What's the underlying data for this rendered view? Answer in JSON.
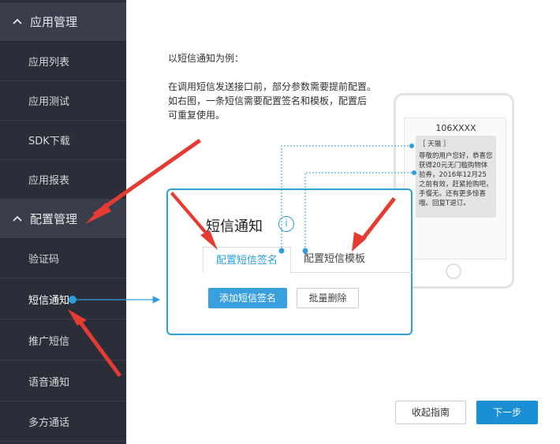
{
  "sidebar": {
    "sections": [
      {
        "title": "应用管理",
        "items": [
          "应用列表",
          "应用测试",
          "SDK下载",
          "应用报表"
        ]
      },
      {
        "title": "配置管理",
        "items": [
          "验证码",
          "短信通知",
          "推广短信",
          "语音通知",
          "多方通话"
        ]
      }
    ]
  },
  "guide": {
    "intro_title": "以短信通知为例：",
    "intro_lines": [
      "在调用短信发送接口前，部分参数需要提前配置。",
      "如右图，一条短信需要配置签名和模板，配置后",
      "可重复使用。"
    ],
    "card": {
      "title": "短信通知",
      "info_glyph": "i",
      "tab_signature": "配置短信签名",
      "tab_template": "配置短信模板",
      "add_button": "添加短信签名",
      "batch_delete_button": "批量删除"
    },
    "phone": {
      "sender": "106XXXX",
      "signature": "［ 天猫 ］",
      "message": "尊敬的用户您好，恭喜您获得20元无门槛购物体验券，2016年12月25之前有效，赶紧抢购吧，手慢无。还有更多惊喜哦。回复T退订。"
    },
    "collapse_button": "收起指南",
    "next_button": "下一步"
  },
  "colors": {
    "sidebar_bg": "#2b2e38",
    "accent": "#2e9fdd",
    "primary_button": "#1a8fd6",
    "arrow": "#e53b33"
  }
}
